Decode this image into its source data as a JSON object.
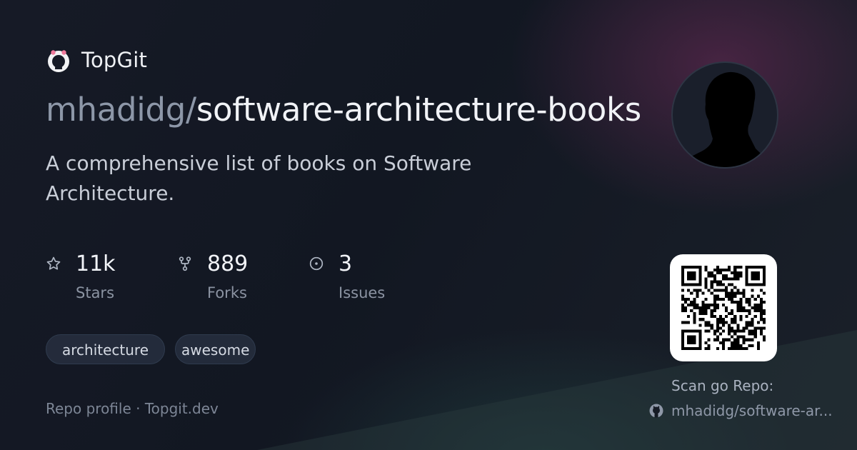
{
  "brand": {
    "name": "TopGit",
    "logo_icon": "topgit-octocat-icon"
  },
  "repo": {
    "owner": "mhadidg/",
    "name": "software-architecture-books",
    "description": "A comprehensive list of books on Software Architecture."
  },
  "stats": [
    {
      "icon": "star-icon",
      "value": "11k",
      "label": "Stars"
    },
    {
      "icon": "fork-icon",
      "value": "889",
      "label": "Forks"
    },
    {
      "icon": "issue-icon",
      "value": "3",
      "label": "Issues"
    }
  ],
  "topics": [
    "architecture",
    "awesome"
  ],
  "footer": {
    "text": "Repo profile · Topgit.dev"
  },
  "qr": {
    "label": "Scan go Repo:",
    "link_text": "mhadidg/software-ar...",
    "link_icon": "github-icon"
  },
  "colors": {
    "background": "#131824",
    "accent_glow": "#782d5f",
    "owner_text": "#8d97a8",
    "title_text": "#f1f3f7",
    "muted_text": "#8b93a2"
  }
}
